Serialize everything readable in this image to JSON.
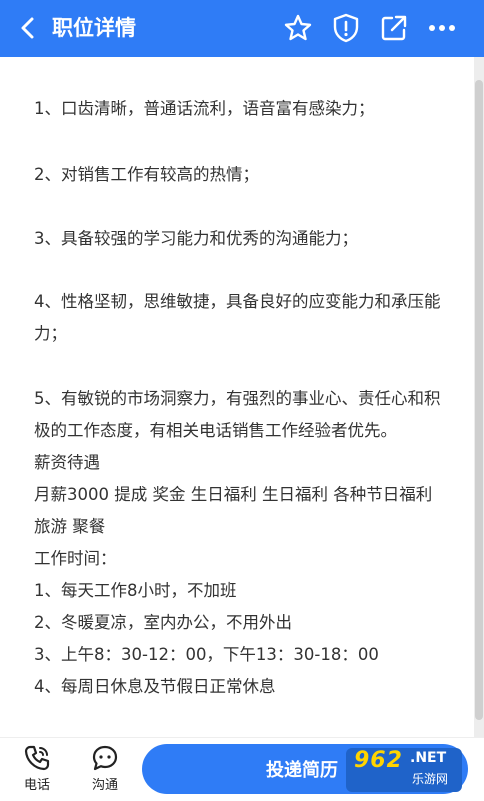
{
  "header": {
    "title": "职位详情"
  },
  "content": {
    "lines": [
      "1、口齿清晰，普通话流利，语音富有感染力；",
      "2、对销售工作有较高的热情；",
      "3、具备较强的学习能力和优秀的沟通能力；",
      "4、性格坚韧，思维敏捷，具备良好的应变能力和承压能",
      "力；",
      "5、有敏锐的市场洞察力，有强烈的事业心、责任心和积",
      "极的工作态度，有相关电话销售工作经验者优先。",
      "薪资待遇",
      "月薪3000 提成 奖金 生日福利 生日福利 各种节日福利",
      "旅游 聚餐",
      "工作时间：",
      "1、每天工作8小时，不加班",
      "2、冬暖夏凉，室内办公，不用外出",
      "3、上午8：30-12：00，下午13：30-18：00",
      "4、每周日休息及节假日正常休息"
    ]
  },
  "bottom": {
    "phone_label": "电话",
    "chat_label": "沟通",
    "apply_label": "投递简历"
  },
  "watermark": {
    "number": "962",
    "net": ".NET",
    "site": "乐游网"
  },
  "colors": {
    "brand": "#2f7cf6"
  }
}
